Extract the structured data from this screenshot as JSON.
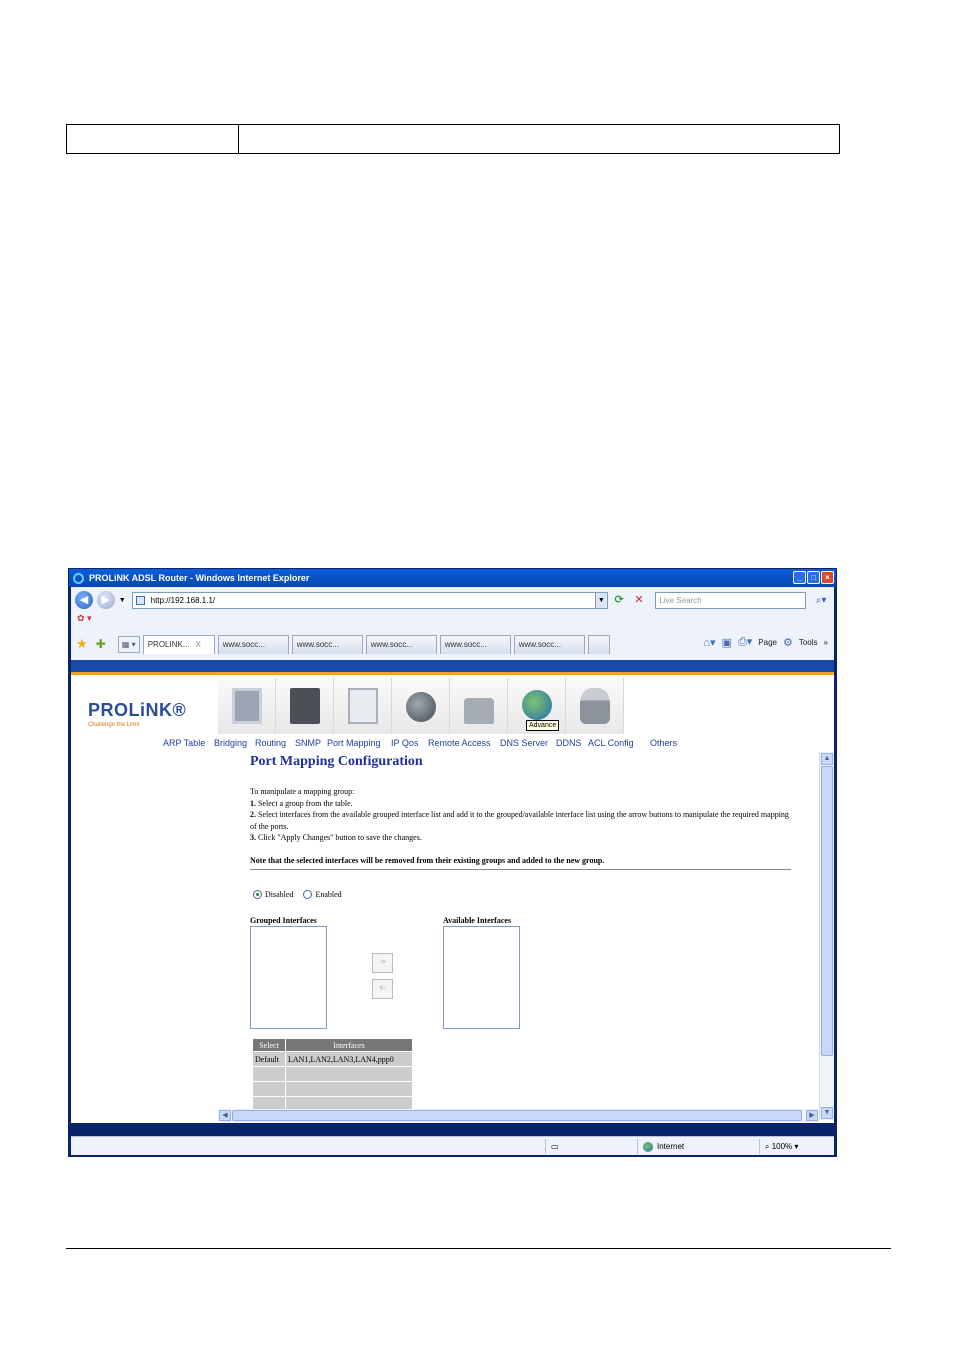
{
  "window": {
    "title": "PROLiNK ADSL Router - Windows Internet Explorer",
    "controls": [
      "_",
      "□",
      "×"
    ]
  },
  "browser": {
    "address": "http://192.168.1.1/",
    "search_placeholder": "Live Search",
    "tabs": [
      {
        "label": "PROLINK...",
        "close": "X"
      },
      {
        "label": "www.socc..."
      },
      {
        "label": "www.socc..."
      },
      {
        "label": "www.socc..."
      },
      {
        "label": "www.socc..."
      },
      {
        "label": "www.socc..."
      }
    ],
    "command_bar": {
      "page": "Page",
      "tools": "Tools",
      "more": "»"
    }
  },
  "router": {
    "brand": "PROLiNK®",
    "slogan": "Challenge the Limit",
    "tooltip": "Advance",
    "subnav": [
      "ARP Table",
      "Bridging",
      "Routing",
      "SNMP",
      "Port Mapping",
      "IP Qos",
      "Remote Access",
      "DNS Server",
      "DDNS",
      "ACL Config",
      "Others"
    ]
  },
  "page": {
    "title": "Port Mapping Configuration",
    "instructions": {
      "intro": "To manipulate a mapping group:",
      "step1_num": "1.",
      "step1": " Select a group from the table.",
      "step2_num": "2.",
      "step2": " Select interfaces from the available grouped interface list and add it to the grouped/available interface list using the arrow buttons to manipulate the required mapping of the ports.",
      "step3_num": "3.",
      "step3": " Click \"Apply Changes\" button to save the changes."
    },
    "note": "Note that the selected interfaces will be removed from their existing groups and added to the new group.",
    "radio_disabled": "Disabled",
    "radio_enabled": "Enabled",
    "selected_mode": "Disabled",
    "grouped_label": "Grouped Interfaces",
    "available_label": "Available Interfaces",
    "add_button": "->",
    "remove_button": "<-",
    "table": {
      "headers": [
        "Select",
        "Interfaces"
      ],
      "rows": [
        {
          "select": "Default",
          "interfaces": "LAN1,LAN2,LAN3,LAN4,ppp0"
        },
        {
          "select": "",
          "interfaces": ""
        },
        {
          "select": "",
          "interfaces": ""
        },
        {
          "select": "",
          "interfaces": ""
        }
      ]
    }
  },
  "status": {
    "zone": "Internet",
    "zoom": "100%"
  }
}
